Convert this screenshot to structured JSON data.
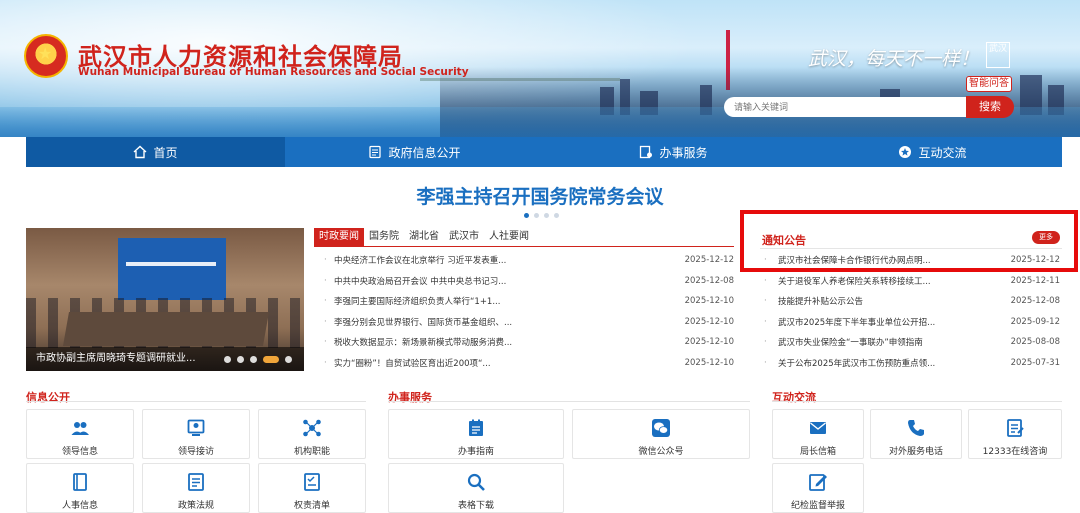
{
  "header": {
    "title_cn": "武汉市人力资源和社会保障局",
    "title_en": "Wuhan Municipal Bureau of Human Resources and Social Security",
    "slogan": "武汉，每天不一样！",
    "seal_text": "武汉",
    "ai_button": "智能问答",
    "search_placeholder": "请输入关键词",
    "search_button": "搜索"
  },
  "nav": {
    "items": [
      {
        "label": "首页",
        "icon": "home-icon"
      },
      {
        "label": "政府信息公开",
        "icon": "document-icon"
      },
      {
        "label": "办事服务",
        "icon": "service-icon"
      },
      {
        "label": "互动交流",
        "icon": "star-icon"
      }
    ]
  },
  "headline": "李强主持召开国务院常务会议",
  "photo": {
    "caption": "市政协副主席周晓琦专题调研就业..."
  },
  "news": {
    "tabs": [
      "时政要闻",
      "国务院",
      "湖北省",
      "武汉市",
      "人社要闻"
    ],
    "items": [
      {
        "title": "中央经济工作会议在北京举行 习近平发表重...",
        "date": "2025-12-12"
      },
      {
        "title": "中共中央政治局召开会议 中共中央总书记习...",
        "date": "2025-12-08"
      },
      {
        "title": "李强同主要国际经济组织负责人举行“1+1...",
        "date": "2025-12-10"
      },
      {
        "title": "李强分别会见世界银行、国际货币基金组织、...",
        "date": "2025-12-10"
      },
      {
        "title": "税收大数据显示：新场景新模式带动服务消费...",
        "date": "2025-12-10"
      },
      {
        "title": "实力“圈粉”！自贸试验区育出近200项“...",
        "date": "2025-12-10"
      }
    ]
  },
  "notice": {
    "title": "通知公告",
    "more": "更多",
    "items": [
      {
        "title": "武汉市社会保障卡合作银行代办网点明...",
        "date": "2025-12-12"
      },
      {
        "title": "关于退役军人养老保险关系转移接续工...",
        "date": "2025-12-11"
      },
      {
        "title": "技能提升补贴公示公告",
        "date": "2025-12-08"
      },
      {
        "title": "武汉市2025年度下半年事业单位公开招...",
        "date": "2025-09-12"
      },
      {
        "title": "武汉市失业保险金“一事联办”申领指南",
        "date": "2025-08-08"
      },
      {
        "title": "关于公布2025年武汉市工伤预防重点领...",
        "date": "2025-07-31"
      }
    ]
  },
  "sections": {
    "info": {
      "title": "信息公开",
      "cards": [
        {
          "label": "领导信息",
          "icon": "people-icon"
        },
        {
          "label": "领导接访",
          "icon": "reception-icon"
        },
        {
          "label": "机构职能",
          "icon": "org-icon"
        },
        {
          "label": "人事信息",
          "icon": "book-icon"
        },
        {
          "label": "政策法规",
          "icon": "policy-icon"
        },
        {
          "label": "权责清单",
          "icon": "list-icon"
        }
      ]
    },
    "service": {
      "title": "办事服务",
      "cards": [
        {
          "label": "办事指南",
          "icon": "guide-icon"
        },
        {
          "label": "微信公众号",
          "icon": "wechat-icon"
        },
        {
          "label": "表格下载",
          "icon": "search-icon"
        }
      ]
    },
    "interact": {
      "title": "互动交流",
      "cards": [
        {
          "label": "局长信箱",
          "icon": "mail-icon"
        },
        {
          "label": "对外服务电话",
          "icon": "phone-icon"
        },
        {
          "label": "12333在线咨询",
          "icon": "consult-icon"
        },
        {
          "label": "纪检监督举报",
          "icon": "edit-icon"
        }
      ]
    }
  },
  "colors": {
    "brand_red": "#d0231c",
    "nav_blue": "#1a6fc0",
    "highlight_box": "#e60b0b"
  }
}
